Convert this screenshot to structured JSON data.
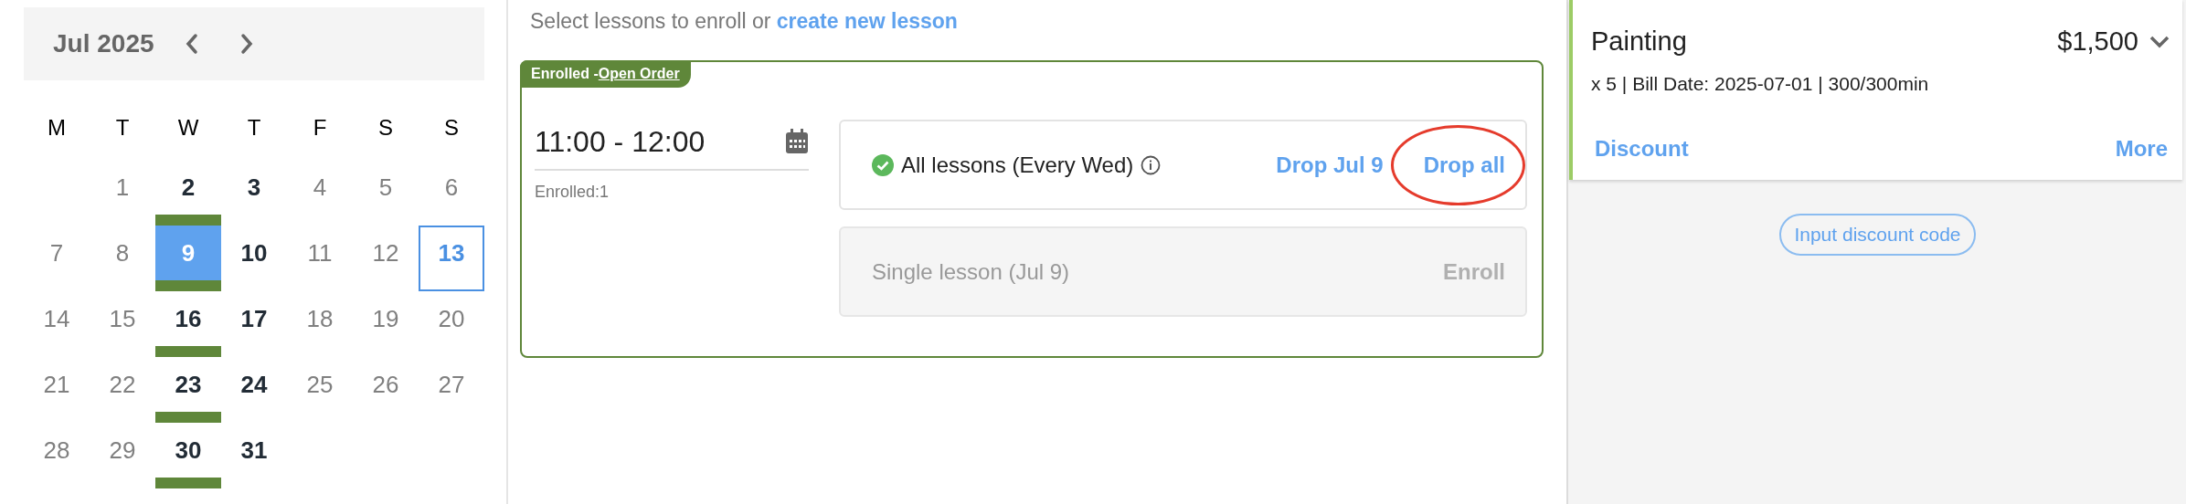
{
  "calendar": {
    "month": "Jul 2025",
    "weekdays": [
      "M",
      "T",
      "W",
      "T",
      "F",
      "S",
      "S"
    ],
    "weeks": [
      [
        {
          "day": "1",
          "has_lessons": false,
          "enrolled": false,
          "selected": false,
          "today": false
        },
        {
          "day": "2",
          "has_lessons": true,
          "enrolled": true,
          "selected": false,
          "today": false
        },
        {
          "day": "3",
          "has_lessons": true,
          "enrolled": false,
          "selected": false,
          "today": false
        },
        {
          "day": "4",
          "has_lessons": false,
          "enrolled": false,
          "selected": false,
          "today": false
        },
        {
          "day": "5",
          "has_lessons": false,
          "enrolled": false,
          "selected": false,
          "today": false
        },
        {
          "day": "6",
          "has_lessons": false,
          "enrolled": false,
          "selected": false,
          "today": false
        }
      ],
      [
        {
          "day": "7",
          "has_lessons": false,
          "enrolled": false,
          "selected": false,
          "today": false
        },
        {
          "day": "8",
          "has_lessons": false,
          "enrolled": false,
          "selected": false,
          "today": false
        },
        {
          "day": "9",
          "has_lessons": true,
          "enrolled": true,
          "selected": true,
          "today": false
        },
        {
          "day": "10",
          "has_lessons": true,
          "enrolled": false,
          "selected": false,
          "today": false
        },
        {
          "day": "11",
          "has_lessons": false,
          "enrolled": false,
          "selected": false,
          "today": false
        },
        {
          "day": "12",
          "has_lessons": false,
          "enrolled": false,
          "selected": false,
          "today": false
        },
        {
          "day": "13",
          "has_lessons": false,
          "enrolled": false,
          "selected": false,
          "today": true
        }
      ],
      [
        {
          "day": "14",
          "has_lessons": false,
          "enrolled": false,
          "selected": false,
          "today": false
        },
        {
          "day": "15",
          "has_lessons": false,
          "enrolled": false,
          "selected": false,
          "today": false
        },
        {
          "day": "16",
          "has_lessons": true,
          "enrolled": true,
          "selected": false,
          "today": false
        },
        {
          "day": "17",
          "has_lessons": true,
          "enrolled": false,
          "selected": false,
          "today": false
        },
        {
          "day": "18",
          "has_lessons": false,
          "enrolled": false,
          "selected": false,
          "today": false
        },
        {
          "day": "19",
          "has_lessons": false,
          "enrolled": false,
          "selected": false,
          "today": false
        },
        {
          "day": "20",
          "has_lessons": false,
          "enrolled": false,
          "selected": false,
          "today": false
        }
      ],
      [
        {
          "day": "21",
          "has_lessons": false,
          "enrolled": false,
          "selected": false,
          "today": false
        },
        {
          "day": "22",
          "has_lessons": false,
          "enrolled": false,
          "selected": false,
          "today": false
        },
        {
          "day": "23",
          "has_lessons": true,
          "enrolled": true,
          "selected": false,
          "today": false
        },
        {
          "day": "24",
          "has_lessons": true,
          "enrolled": false,
          "selected": false,
          "today": false
        },
        {
          "day": "25",
          "has_lessons": false,
          "enrolled": false,
          "selected": false,
          "today": false
        },
        {
          "day": "26",
          "has_lessons": false,
          "enrolled": false,
          "selected": false,
          "today": false
        },
        {
          "day": "27",
          "has_lessons": false,
          "enrolled": false,
          "selected": false,
          "today": false
        }
      ],
      [
        {
          "day": "28",
          "has_lessons": false,
          "enrolled": false,
          "selected": false,
          "today": false
        },
        {
          "day": "29",
          "has_lessons": false,
          "enrolled": false,
          "selected": false,
          "today": false
        },
        {
          "day": "30",
          "has_lessons": true,
          "enrolled": true,
          "selected": false,
          "today": false
        },
        {
          "day": "31",
          "has_lessons": true,
          "enrolled": false,
          "selected": false,
          "today": false
        }
      ]
    ]
  },
  "lessons": {
    "prompt": "Select lessons to enroll or ",
    "prompt_link": "create new lesson",
    "card": {
      "tag": "Enrolled -",
      "tag_link": "Open Order",
      "time": "11:00 - 12:00",
      "enrolled_count": "Enrolled:1",
      "options": [
        {
          "label": "All lessons (Every Wed)",
          "enrolled": true,
          "actions": [
            {
              "label": "Drop Jul 9",
              "circled": false
            },
            {
              "label": "Drop all",
              "circled": true
            }
          ]
        },
        {
          "label": "Single lesson (Jul 9)",
          "enrolled": false,
          "actions": [
            {
              "label": "Enroll",
              "circled": false
            }
          ]
        }
      ]
    }
  },
  "order": {
    "item": "Painting",
    "price": "$1,500",
    "details": "x 5 | Bill Date: 2025-07-01 | 300/300min",
    "actions": [
      "Discount",
      "More"
    ],
    "discount_code_button": "Input discount code"
  }
}
